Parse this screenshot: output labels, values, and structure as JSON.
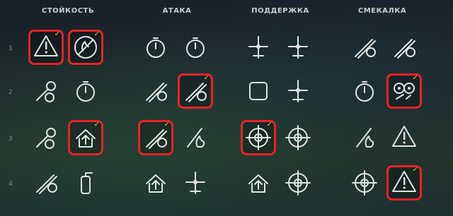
{
  "columns": [
    {
      "key": "survivability",
      "title": "СТОЙКОСТЬ"
    },
    {
      "key": "attack",
      "title": "АТАКА"
    },
    {
      "key": "support",
      "title": "ПОДДЕРЖКА"
    },
    {
      "key": "versatility",
      "title": "СМЕКАЛКА"
    }
  ],
  "tiers": [
    "1",
    "2",
    "3",
    "4"
  ],
  "colors": {
    "selection": "#e8222a",
    "checkmark": "#f2b631",
    "icon": "#dfe5e5"
  },
  "check_glyph": "✓",
  "skills": [
    {
      "col": 0,
      "tier": 1,
      "icon": "warning-triangle-crosshair-icon",
      "selected": true
    },
    {
      "col": 0,
      "tier": 1,
      "icon": "no-fire-circle-icon",
      "selected": true
    },
    {
      "col": 0,
      "tier": 2,
      "icon": "wrench-gauge-icon",
      "selected": false
    },
    {
      "col": 0,
      "tier": 2,
      "icon": "stopwatch-icon",
      "selected": false
    },
    {
      "col": 0,
      "tier": 3,
      "icon": "wrench-arrow-up-icon",
      "selected": false
    },
    {
      "col": 0,
      "tier": 3,
      "icon": "ship-house-arrow-icon",
      "selected": true
    },
    {
      "col": 0,
      "tier": 4,
      "icon": "shells-hand-icon",
      "selected": false
    },
    {
      "col": 0,
      "tier": 4,
      "icon": "extinguisher-icon",
      "selected": false
    },
    {
      "col": 1,
      "tier": 1,
      "icon": "torpedo-gauge-icon",
      "selected": false
    },
    {
      "col": 1,
      "tier": 1,
      "icon": "plane-gauge-icon",
      "selected": false
    },
    {
      "col": 1,
      "tier": 2,
      "icon": "shell-hand-icon",
      "selected": false
    },
    {
      "col": 1,
      "tier": 2,
      "icon": "gun-barrel-icon",
      "selected": true
    },
    {
      "col": 1,
      "tier": 3,
      "icon": "torpedo-speed-icon",
      "selected": true
    },
    {
      "col": 1,
      "tier": 3,
      "icon": "bomb-fire-icon",
      "selected": false
    },
    {
      "col": 1,
      "tier": 4,
      "icon": "rockets-arrow-icon",
      "selected": false
    },
    {
      "col": 1,
      "tier": 4,
      "icon": "planes-cross-icon",
      "selected": false
    },
    {
      "col": 2,
      "tier": 1,
      "icon": "planes-crosshair-icon",
      "selected": false
    },
    {
      "col": 2,
      "tier": 1,
      "icon": "plane-house-icon",
      "selected": false
    },
    {
      "col": 2,
      "tier": 2,
      "icon": "ship-armor-icon",
      "selected": false
    },
    {
      "col": 2,
      "tier": 2,
      "icon": "plane-crosshair-icon",
      "selected": false
    },
    {
      "col": 2,
      "tier": 3,
      "icon": "crosshairs-arrow-up-icon",
      "selected": true
    },
    {
      "col": 2,
      "tier": 3,
      "icon": "crosshair-plus-icon",
      "selected": false
    },
    {
      "col": 2,
      "tier": 4,
      "icon": "gun-arrows-icon",
      "selected": false
    },
    {
      "col": 2,
      "tier": 4,
      "icon": "radar-crosshair-icon",
      "selected": false
    },
    {
      "col": 3,
      "tier": 1,
      "icon": "torpedo-cone-icon",
      "selected": false
    },
    {
      "col": 3,
      "tier": 1,
      "icon": "mine-plus-icon",
      "selected": false
    },
    {
      "col": 3,
      "tier": 2,
      "icon": "torpedo-gauge-icon",
      "selected": false
    },
    {
      "col": 3,
      "tier": 2,
      "icon": "gear-wrench-icon",
      "selected": true
    },
    {
      "col": 3,
      "tier": 3,
      "icon": "torpedoes-fire-icon",
      "selected": false
    },
    {
      "col": 3,
      "tier": 3,
      "icon": "torpedo-warning-icon",
      "selected": false
    },
    {
      "col": 3,
      "tier": 4,
      "icon": "radar-circle-icon",
      "selected": false
    },
    {
      "col": 3,
      "tier": 4,
      "icon": "warning-arrow-down-icon",
      "selected": true
    }
  ]
}
